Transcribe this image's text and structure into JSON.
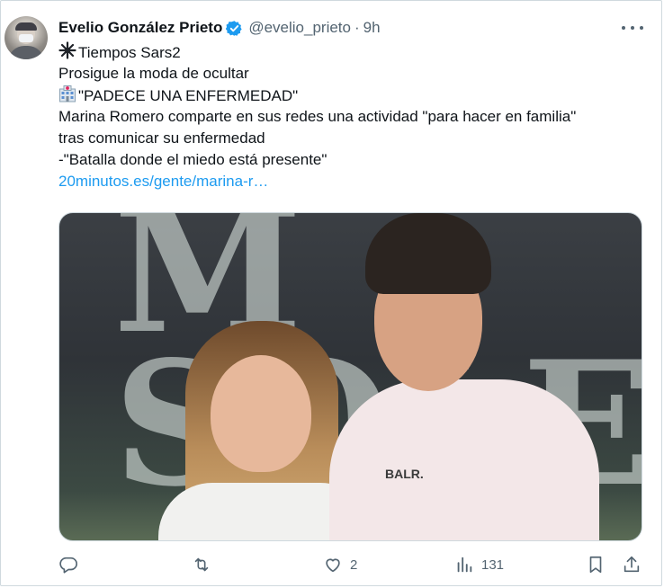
{
  "tweet": {
    "author_name": "Evelio González Prieto",
    "handle": "@evelio_prieto",
    "separator": "·",
    "time": "9h",
    "lines": [
      {
        "icon": "",
        "text": "Tiempos Sars2"
      },
      {
        "icon": "",
        "text": "Prosigue la moda de ocultar"
      },
      {
        "icon": "",
        "text": "\"PADECE UNA ENFERMEDAD\""
      },
      {
        "icon": "",
        "text": "Marina Romero comparte en sus redes una actividad \"para hacer en familia\""
      },
      {
        "icon": "",
        "text": "tras comunicar su enfermedad"
      },
      {
        "icon": "",
        "text": "-\"Batalla donde el miedo está presente\""
      }
    ],
    "link_text": "20minutos.es/gente/marina-r…",
    "media": {
      "background_letters": "M\nSOLEDAD",
      "shirt_text": "BALR."
    }
  },
  "actions": {
    "reply_count": "",
    "retweet_count": "",
    "like_count": "2",
    "views_count": "131"
  },
  "colors": {
    "link": "#1d9bf0",
    "muted": "#536471",
    "verified": "#1d9bf0"
  },
  "icons": [
    "avatar",
    "verified-badge-icon",
    "more-icon",
    "sparkle-icon",
    "hospital-icon",
    "reply-icon",
    "retweet-icon",
    "like-icon",
    "views-icon",
    "bookmark-icon",
    "share-icon"
  ]
}
